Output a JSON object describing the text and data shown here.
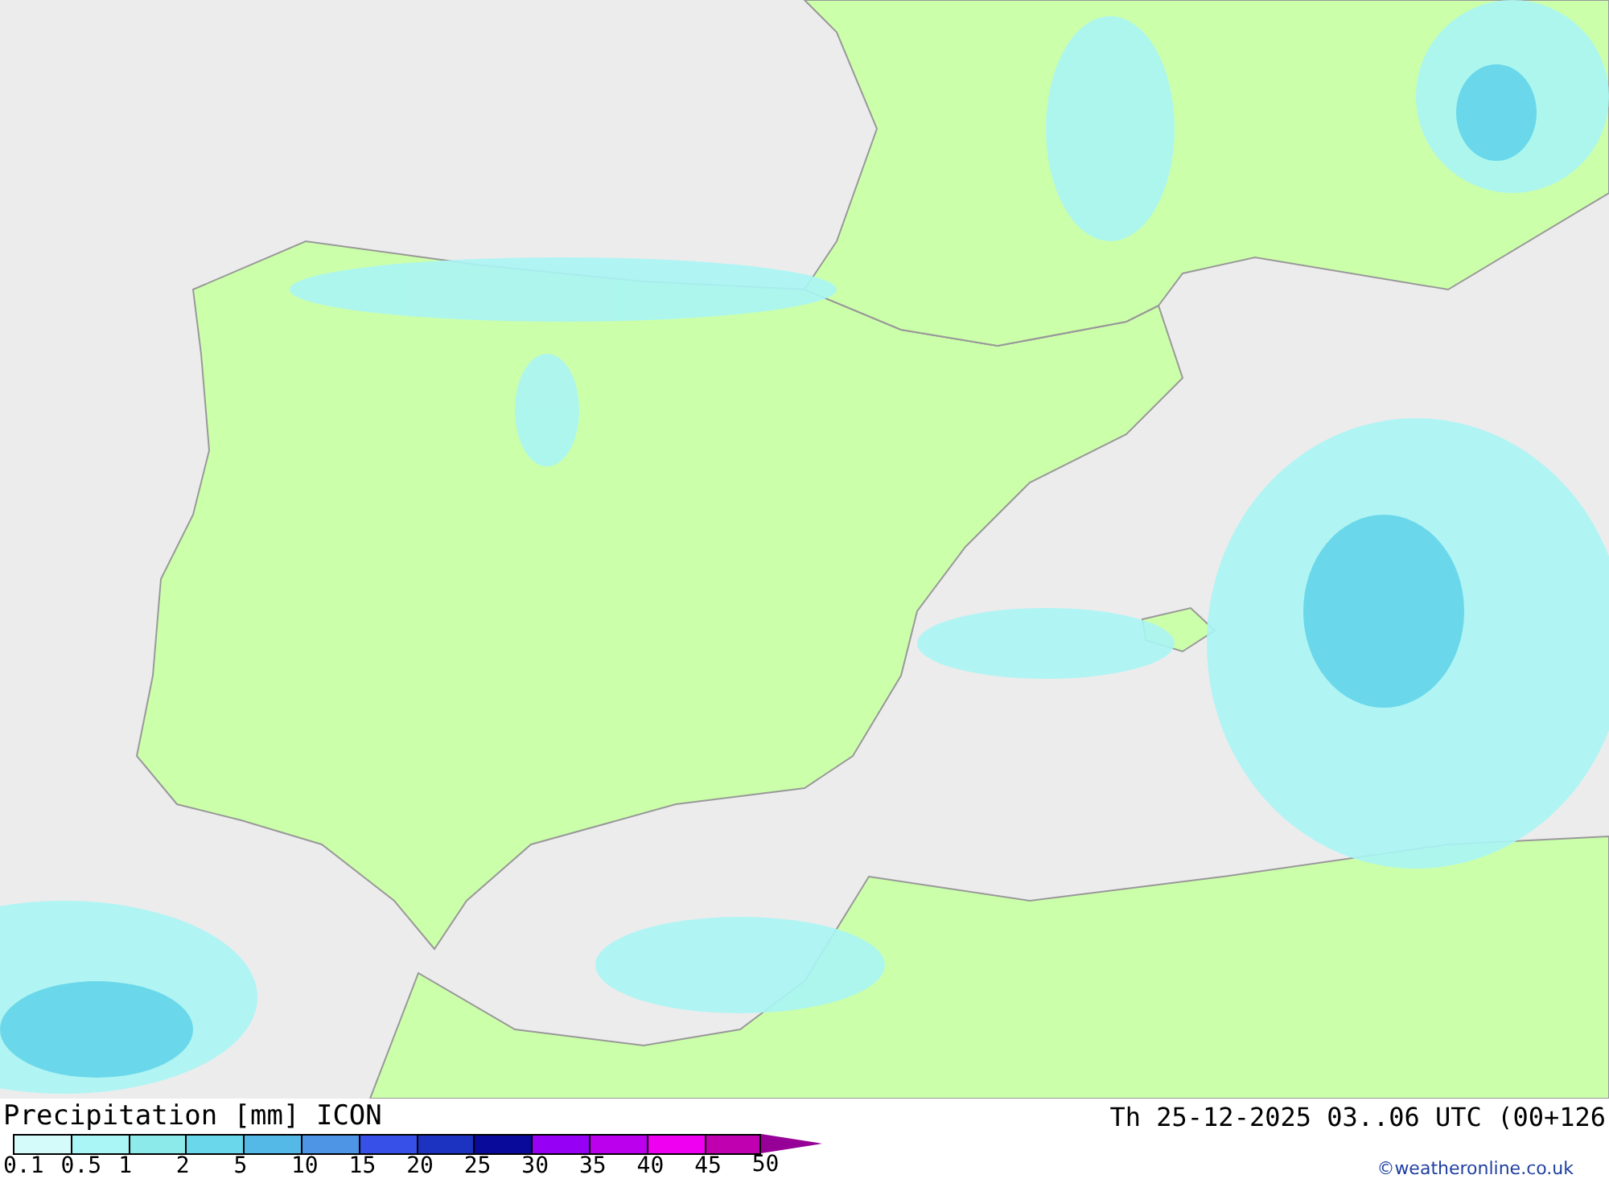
{
  "map": {
    "title": "Precipitation [mm] ICON",
    "valid_time": "Th 25-12-2025 03..06 UTC (00+126",
    "credit": "©weatheronline.co.uk"
  },
  "legend": [
    {
      "kind": "swatch",
      "label": "0.1",
      "color": "#d4fafa"
    },
    {
      "kind": "swatch",
      "label": "0.5",
      "color": "#aaf5f5"
    },
    {
      "kind": "swatch",
      "label": "1",
      "color": "#8ceaea"
    },
    {
      "kind": "swatch",
      "label": "2",
      "color": "#6ad8ea"
    },
    {
      "kind": "swatch",
      "label": "5",
      "color": "#55b9e8"
    },
    {
      "kind": "swatch",
      "label": "10",
      "color": "#4e95e6"
    },
    {
      "kind": "swatch",
      "label": "15",
      "color": "#3750e8"
    },
    {
      "kind": "swatch",
      "label": "20",
      "color": "#1c32c0"
    },
    {
      "kind": "swatch",
      "label": "25",
      "color": "#0a0a9a"
    },
    {
      "kind": "swatch",
      "label": "30",
      "color": "#9600f5"
    },
    {
      "kind": "swatch",
      "label": "35",
      "color": "#bb00ee"
    },
    {
      "kind": "swatch",
      "label": "40",
      "color": "#f000f0"
    },
    {
      "kind": "swatch",
      "label": "45",
      "color": "#c000b0"
    },
    {
      "kind": "arrow",
      "label": "50",
      "color": "#960096"
    }
  ]
}
